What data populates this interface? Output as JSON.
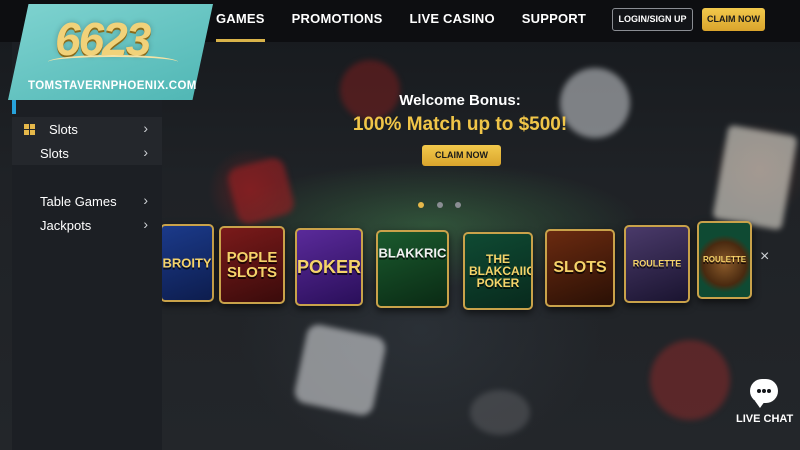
{
  "logo": {
    "number": "6623",
    "site": "TOMSTAVERNPHOENIX.COM"
  },
  "nav": {
    "items": [
      {
        "label": "GAMES",
        "active": true
      },
      {
        "label": "PROMOTIONS",
        "active": false
      },
      {
        "label": "LIVE CASINO",
        "active": false
      },
      {
        "label": "SUPPORT",
        "active": false
      }
    ],
    "login_label": "LOGIN/SIGN UP",
    "claim_label": "CLAIM NOW"
  },
  "sidebar": {
    "items": [
      {
        "label": "Slots",
        "icon": "grid-icon"
      },
      {
        "label": "Slots"
      },
      {
        "label": "Table Games"
      },
      {
        "label": "Jackpots"
      }
    ],
    "chevron": "›"
  },
  "hero": {
    "title": "Welcome Bonus:",
    "subtitle": "100% Match up to $500!",
    "button_label": "CLAIM NOW",
    "slides": 3,
    "active_slide": 1
  },
  "games": [
    {
      "title": "BROITY"
    },
    {
      "title": "POPLE SLOTS"
    },
    {
      "title": "POKER"
    },
    {
      "title": "BLAKKRIC"
    },
    {
      "title": "THE BLAKCAIIC POKER"
    },
    {
      "title": "SLOTS"
    },
    {
      "title": "ROULETTE"
    },
    {
      "title": "ROULETTE"
    }
  ],
  "close_symbol": "×",
  "live_chat": {
    "label": "LIVE CHAT"
  },
  "colors": {
    "accent_gold": "#e6b84a",
    "teal_logo": "#5fc3c1",
    "sidebar_accent": "#27a2db"
  }
}
